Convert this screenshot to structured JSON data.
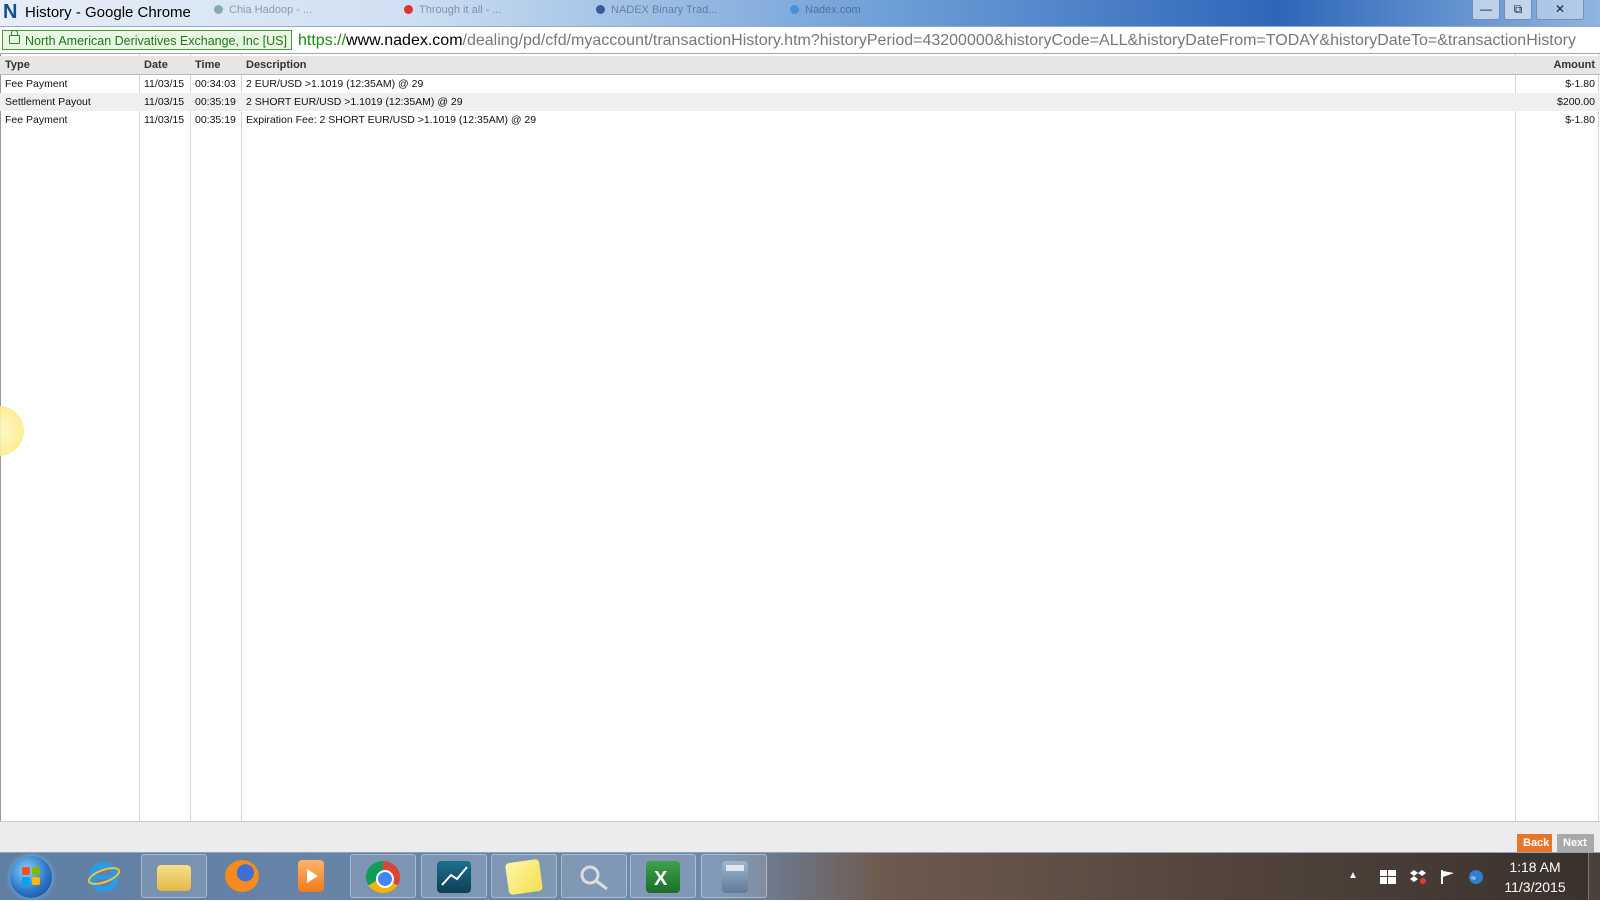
{
  "window": {
    "title": "History - Google Chrome",
    "background_tabs": [
      "Chia Hadoop - ...",
      "Through it all - ...",
      "NADEX Binary Trad...",
      "Nadex.com"
    ]
  },
  "address_bar": {
    "ev_label": "North American Derivatives Exchange, Inc [US]",
    "url_scheme": "https://",
    "url_host": "www.nadex.com",
    "url_path": "/dealing/pd/cfd/myaccount/transactionHistory.htm?historyPeriod=43200000&historyCode=ALL&historyDateFrom=TODAY&historyDateTo=&transactionHistory"
  },
  "table": {
    "headers": {
      "type": "Type",
      "date": "Date",
      "time": "Time",
      "description": "Description",
      "amount": "Amount"
    },
    "rows": [
      {
        "type": "Fee Payment",
        "date": "11/03/15",
        "time": "00:34:03",
        "description": "2 EUR/USD >1.1019 (12:35AM) @ 29",
        "amount": "$-1.80"
      },
      {
        "type": "Settlement Payout",
        "date": "11/03/15",
        "time": "00:35:19",
        "description": "2 SHORT EUR/USD >1.1019 (12:35AM) @ 29",
        "amount": "$200.00"
      },
      {
        "type": "Fee Payment",
        "date": "11/03/15",
        "time": "00:35:19",
        "description": "Expiration Fee: 2 SHORT EUR/USD >1.1019 (12:35AM) @ 29",
        "amount": "$-1.80"
      }
    ]
  },
  "footer": {
    "back_label": "Back",
    "next_label": "Next"
  },
  "taskbar": {
    "apps": [
      "windows-start",
      "internet-explorer",
      "file-explorer",
      "firefox",
      "media-player",
      "chrome",
      "trading-platform",
      "sticky-notes",
      "network-tool",
      "excel",
      "calculator"
    ],
    "clock_time": "1:18 AM",
    "clock_date": "11/3/2015"
  },
  "colors": {
    "back_button": "#e8762a",
    "next_button": "#a9a9a9",
    "ev_green": "#1d7a13",
    "header_bg": "#e6e6e6"
  }
}
